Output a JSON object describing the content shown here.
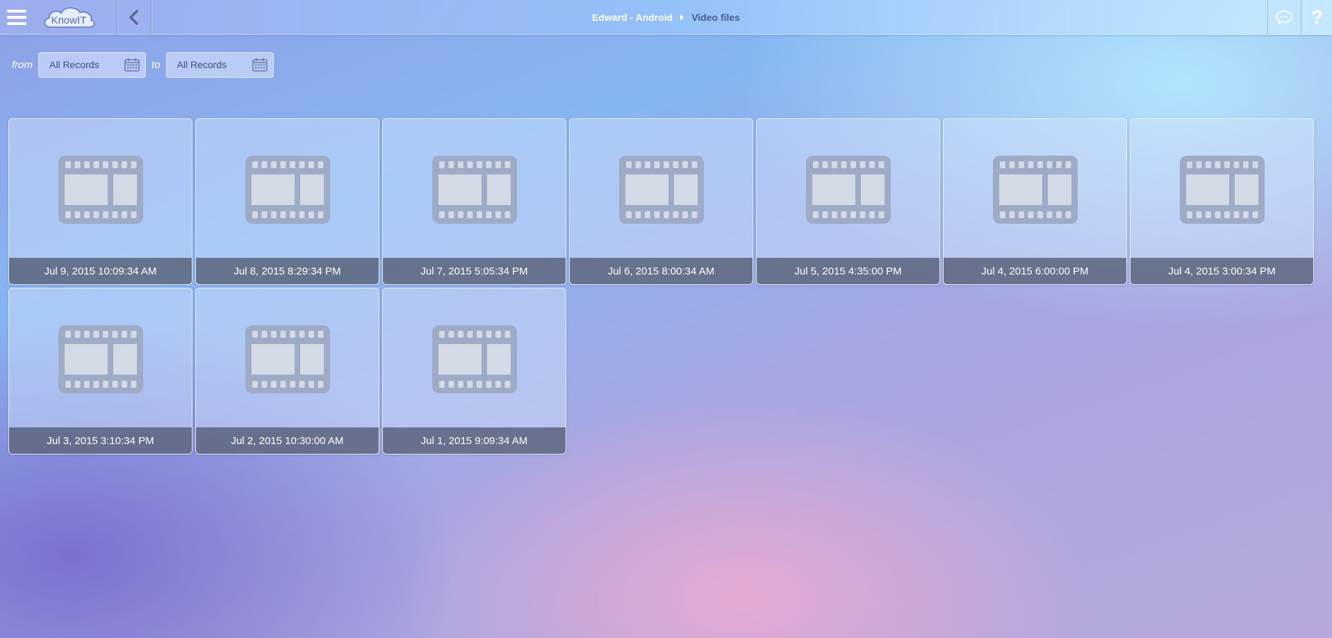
{
  "header": {
    "logo_text": "KnowIT",
    "breadcrumb": {
      "device": "Edward - Android",
      "current": "Video files"
    }
  },
  "filter": {
    "from_label": "from",
    "to_label": "to",
    "from_value": "All Records",
    "to_value": "All Records"
  },
  "videos": [
    {
      "timestamp": "Jul 9, 2015 10:09:34 AM"
    },
    {
      "timestamp": "Jul 8, 2015 8:29:34 PM"
    },
    {
      "timestamp": "Jul 7, 2015 5:05:34 PM"
    },
    {
      "timestamp": "Jul 6, 2015 8:00:34 AM"
    },
    {
      "timestamp": "Jul 5, 2015 4:35:00 PM"
    },
    {
      "timestamp": "Jul 4, 2015 6:00:00 PM"
    },
    {
      "timestamp": "Jul 4, 2015 3:00:34 PM"
    },
    {
      "timestamp": "Jul 3, 2015 3:10:34 PM"
    },
    {
      "timestamp": "Jul 2, 2015 10:30:00 AM"
    },
    {
      "timestamp": "Jul 1, 2015 9:09:34 AM"
    }
  ],
  "icons": {
    "menu": "hamburger-icon",
    "back": "chevron-left-icon",
    "chat": "chat-bubble-icon",
    "help": "question-mark-icon",
    "calendar": "calendar-icon",
    "video": "film-strip-icon"
  },
  "colors": {
    "caption_bg": "#555f78",
    "film_icon": "#9eabc6",
    "breadcrumb_current": "#4a5b88",
    "logo_text": "#4a6fb3"
  }
}
